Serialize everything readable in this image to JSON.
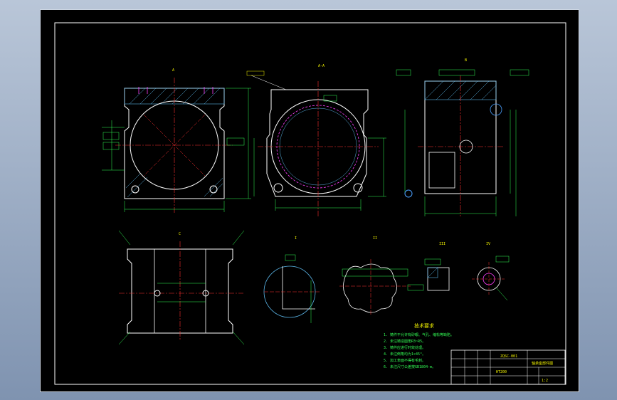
{
  "colors": {
    "background": "#000000",
    "frame": "#ffffff",
    "outline": "#ffffff",
    "hatch": "#5ab4e6",
    "centerline": "#ff3030",
    "dimension": "#33ff55",
    "text": "#f2f200",
    "accent": "#ff40ff",
    "callout": "#4aa0ff"
  },
  "views": {
    "front_view_label": "A",
    "section_view_label": "A-A",
    "side_view_label": "B",
    "bottom_view_label": "C",
    "detail_1_label": "I",
    "detail_2_label": "II",
    "detail_3_label": "III",
    "detail_4_label": "IV"
  },
  "tech_requirements": {
    "heading": "技术要求",
    "items": [
      "1. 铸件不允许有砂眼、气孔、缩松等缺陷。",
      "2. 未注铸造圆角R3~R5。",
      "3. 铸件应进行时效处理。",
      "4. 未注倒角均为1×45°。",
      "5. 加工表面不得有毛刺。",
      "6. 未注尺寸公差按GB1804-m。"
    ]
  },
  "title_block": {
    "drawing_number": "ZQSC-001",
    "part_name": "轴承座部件图",
    "material": "HT200",
    "scale": "1:2"
  }
}
